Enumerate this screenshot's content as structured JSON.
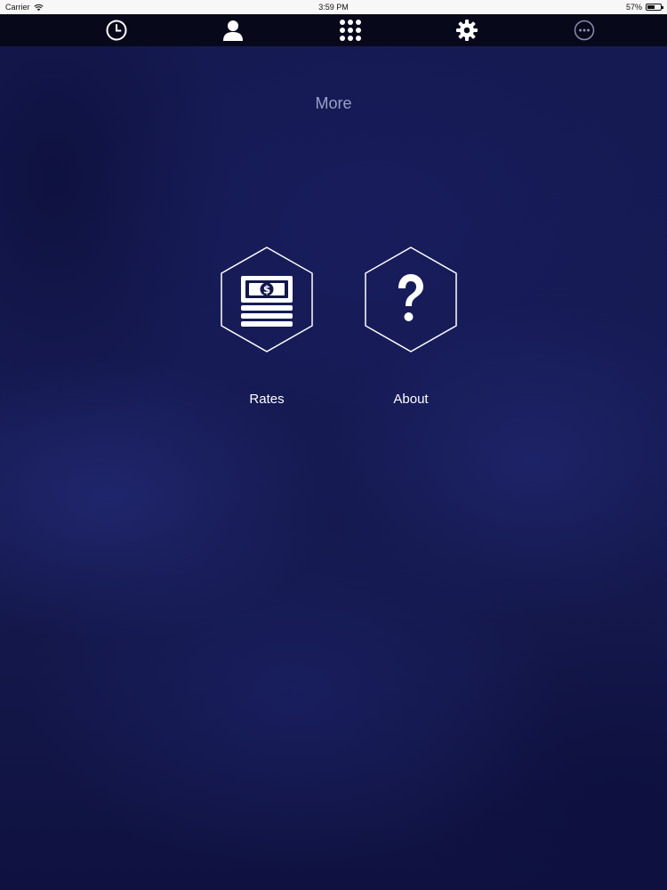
{
  "status_bar": {
    "carrier": "Carrier",
    "time": "3:59 PM",
    "battery_percent": "57%",
    "battery_level": 0.57
  },
  "tab_bar": {
    "tabs": [
      {
        "icon": "clock-icon"
      },
      {
        "icon": "person-icon"
      },
      {
        "icon": "grid-icon"
      },
      {
        "icon": "gear-icon"
      },
      {
        "icon": "more-icon"
      }
    ]
  },
  "page": {
    "title": "More",
    "items": [
      {
        "label": "Rates",
        "icon": "money-stack-icon"
      },
      {
        "label": "About",
        "icon": "question-icon"
      }
    ]
  },
  "colors": {
    "background": "#14174a",
    "tab_bar": "#07081a",
    "title": "#9aa0c7",
    "icon": "#ffffff"
  }
}
